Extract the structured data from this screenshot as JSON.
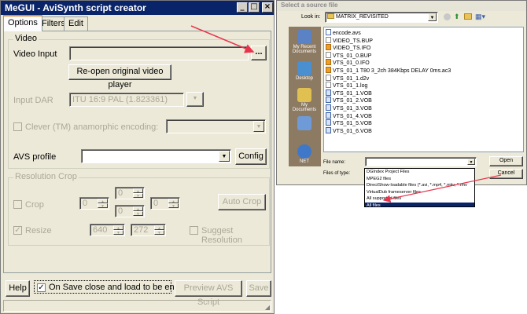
{
  "megui": {
    "title": "MeGUI - AviSynth script creator",
    "tabs": [
      "Options",
      "Filters",
      "Edit"
    ],
    "video_group": "Video",
    "video_input_label": "Video Input",
    "browse_label": "...",
    "reopen_label": "Re-open original video player",
    "input_dar_label": "Input DAR",
    "input_dar_value": "ITU 16:9 PAL (1.823361)",
    "anamorphic_label": "Clever (TM) anamorphic encoding:",
    "avs_profile_label": "AVS profile",
    "config_label": "Config",
    "crop_group": "Resolution Crop",
    "crop_label": "Crop",
    "crop_values": [
      "0",
      "0",
      "0",
      "0"
    ],
    "auto_crop_label": "Auto Crop",
    "resize_label": "Resize",
    "resize_width": "640",
    "resize_height": "272",
    "suggest_label": "Suggest Resolution",
    "help_label": "Help",
    "onsave_label": "On Save close and load to be encoded",
    "preview_label": "Preview AVS Script",
    "save_label": "Save",
    "colors": {
      "title_bar": "#0a246a",
      "window": "#ece9d8",
      "arrow": "#e8344a"
    }
  },
  "dialog": {
    "title": "Select a source file",
    "look_in_label": "Look in:",
    "look_in_value": "MATRIX_REVISITED",
    "places": [
      "My Recent Documents",
      "Desktop",
      "My Documents",
      "",
      "NET"
    ],
    "files": [
      {
        "name": "encode.avs",
        "icon": "script"
      },
      {
        "name": "VIDEO_TS.BUP",
        "icon": "doc"
      },
      {
        "name": "VIDEO_TS.IFO",
        "icon": "media"
      },
      {
        "name": "VTS_01_0.BUP",
        "icon": "doc"
      },
      {
        "name": "VTS_01_0.IFO",
        "icon": "media"
      },
      {
        "name": "VTS_01_1 T80 3_2ch 384Kbps DELAY 0ms.ac3",
        "icon": "media"
      },
      {
        "name": "VTS_01_1.d2v",
        "icon": "doc"
      },
      {
        "name": "VTS_01_1.log",
        "icon": "doc"
      },
      {
        "name": "VTS_01_1.VOB",
        "icon": "video"
      },
      {
        "name": "VTS_01_2.VOB",
        "icon": "video"
      },
      {
        "name": "VTS_01_3.VOB",
        "icon": "video"
      },
      {
        "name": "VTS_01_4.VOB",
        "icon": "video"
      },
      {
        "name": "VTS_01_5.VOB",
        "icon": "video"
      },
      {
        "name": "VTS_01_6.VOB",
        "icon": "video"
      }
    ],
    "file_name_label": "File name:",
    "files_of_type_label": "Files of type:",
    "open_label": "Open",
    "cancel_label": "Cancel",
    "type_options": [
      "DGIndex Project Files",
      "MPEG2 files",
      "DirectShow-loadable files (*.avi, *.mp4, *.mkv, *.rmv",
      "VirtualDub frameserver files",
      "All supported files",
      "All files"
    ],
    "selected_type": "All files"
  }
}
